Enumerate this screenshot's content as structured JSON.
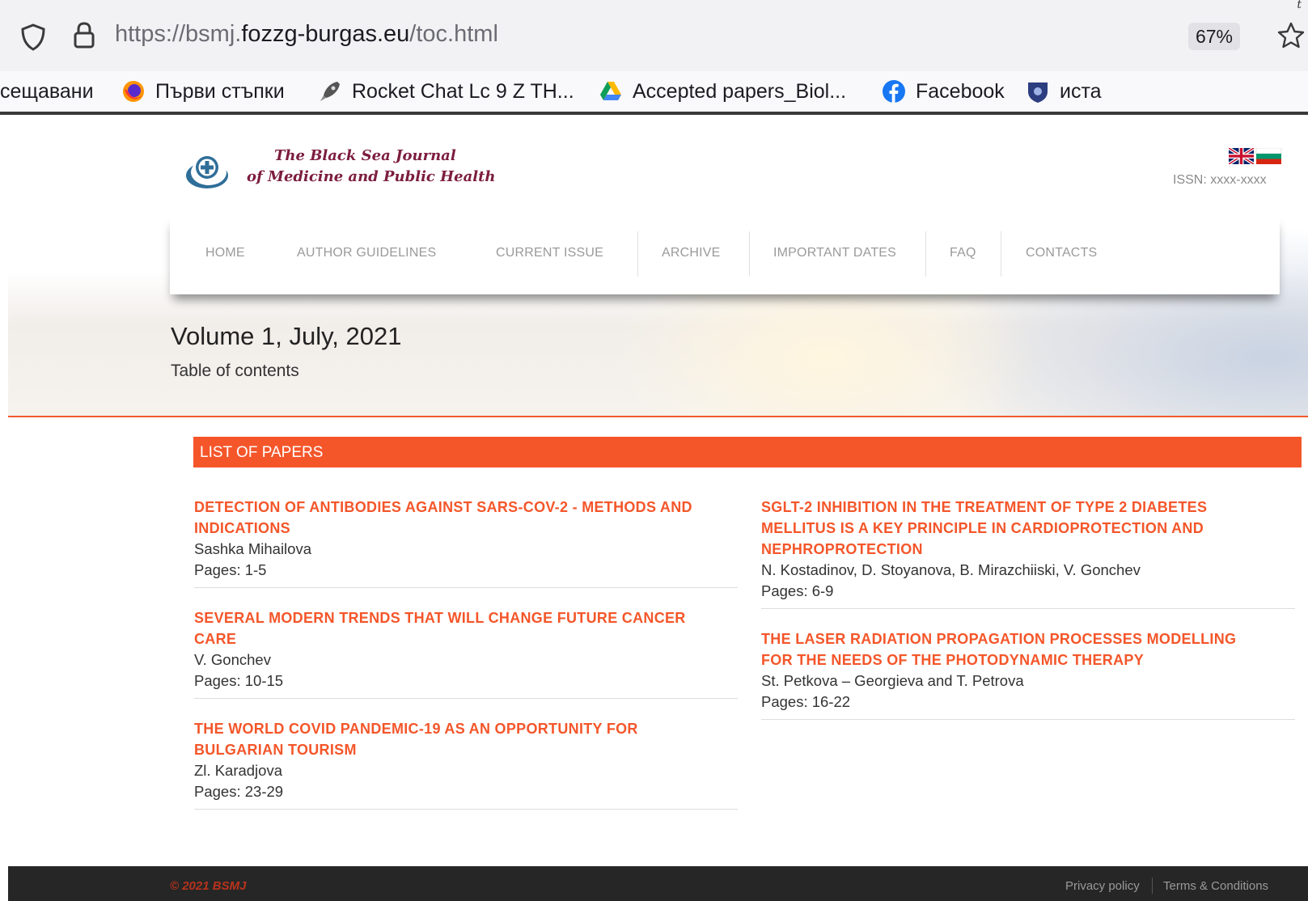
{
  "browser": {
    "url_prefix": "https://bsmj.",
    "url_host": "fozzg-burgas.eu",
    "url_path": "/toc.html",
    "zoom": "67%",
    "corner_mark": "t"
  },
  "bookmarks": [
    {
      "label": "сещавани",
      "icon": "none"
    },
    {
      "label": "Първи стъпки",
      "icon": "firefox-icon"
    },
    {
      "label": "Rocket Chat Lc 9 Z TH...",
      "icon": "rocket-icon"
    },
    {
      "label": "Accepted papers_Biol...",
      "icon": "google-drive-icon"
    },
    {
      "label": "Facebook",
      "icon": "facebook-icon"
    },
    {
      "label": "иста",
      "icon": "shield-crest-icon"
    }
  ],
  "site": {
    "logo_line1": "The Black Sea Journal",
    "logo_line2": "of Medicine and Public Health",
    "issn": "ISSN: xxxx-xxxx",
    "nav": [
      "HOME",
      "AUTHOR GUIDELINES",
      "CURRENT ISSUE",
      "ARCHIVE",
      "IMPORTANT DATES",
      "FAQ",
      "CONTACTS"
    ],
    "volume_title": "Volume 1, July, 2021",
    "toc_label": "Table of contents",
    "list_header": "LIST OF PAPERS",
    "accent_color": "#f4562a"
  },
  "papers_left": [
    {
      "title_lines": [
        "DETECTION OF ANTIBODIES AGAINST SARS-COV-2 - METHODS AND",
        "INDICATIONS"
      ],
      "authors": "Sashka Mihailova",
      "pages": "Pages: 1-5"
    },
    {
      "title_lines": [
        "SEVERAL MODERN TRENDS THAT WILL CHANGE FUTURE CANCER",
        "CARE"
      ],
      "authors": "V. Gonchev",
      "pages": "Pages: 10-15"
    },
    {
      "title_lines": [
        "THE WORLD COVID PANDEMIC-19 AS AN OPPORTUNITY FOR",
        "BULGARIAN TOURISM"
      ],
      "authors": "Zl. Karadjova",
      "pages": "Pages: 23-29"
    }
  ],
  "papers_right": [
    {
      "title_lines": [
        "SGLT-2 INHIBITION IN THE TREATMENT OF TYPE 2 DIABETES",
        "MELLITUS IS A KEY PRINCIPLE IN CARDIOPROTECTION AND",
        "NEPHROPROTECTION"
      ],
      "authors": "N. Kostadinov, D. Stoyanova, B. Mirazchiiski, V. Gonchev",
      "pages": "Pages: 6-9"
    },
    {
      "title_lines": [
        "THE LASER RADIATION PROPAGATION PROCESSES MODELLING",
        "FOR THE NEEDS OF THE PHOTODYNAMIC THERAPY"
      ],
      "authors": "St. Petkova – Georgieva and T. Petrova",
      "pages": "Pages: 16-22"
    }
  ],
  "footer": {
    "copyright": "© 2021 BSMJ",
    "privacy": "Privacy policy",
    "terms": "Terms & Conditions"
  }
}
